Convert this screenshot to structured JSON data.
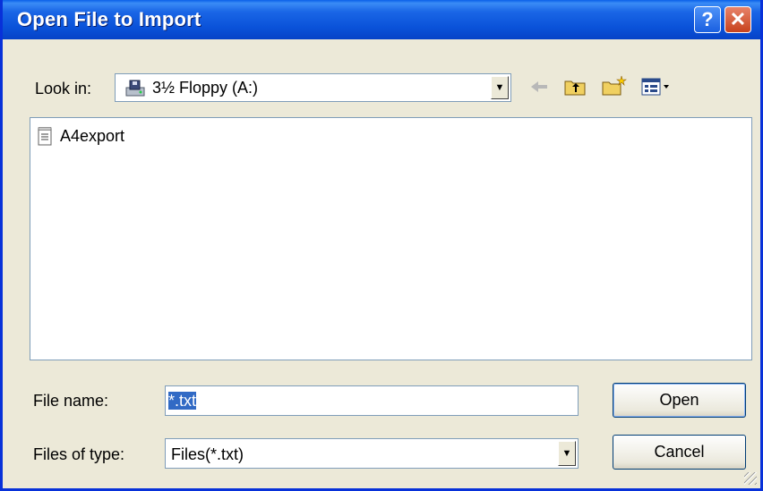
{
  "window": {
    "title": "Open File to Import",
    "help_label": "?",
    "close_label": "✕"
  },
  "look_in": {
    "label": "Look in:",
    "value": "3½ Floppy (A:)",
    "icon": "floppy-drive-icon"
  },
  "toolbar": {
    "back_icon": "back-arrow-icon",
    "up_icon": "up-folder-icon",
    "new_folder_icon": "new-folder-icon",
    "view_menu_icon": "view-menu-icon"
  },
  "files": [
    {
      "name": "A4export",
      "icon": "text-file-icon"
    }
  ],
  "file_name": {
    "label": "File name:",
    "value": "*.txt"
  },
  "file_type": {
    "label": "Files of type:",
    "value": "Files(*.txt)"
  },
  "buttons": {
    "open": "Open",
    "cancel": "Cancel"
  },
  "colors": {
    "title_bar": "#0a52d9",
    "dialog_bg": "#ece9d8",
    "selection": "#316ac5"
  }
}
